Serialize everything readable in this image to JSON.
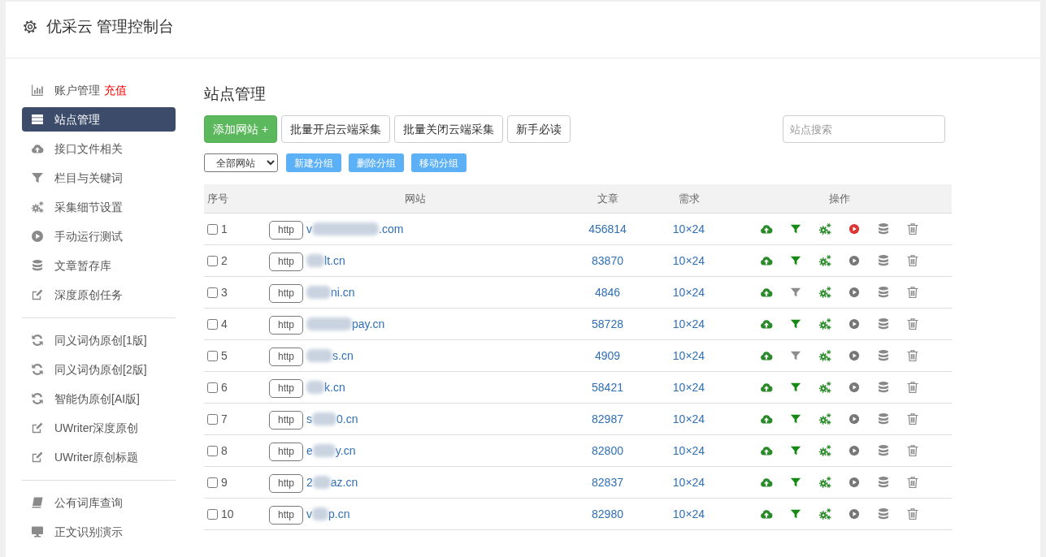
{
  "header": {
    "title": "优采云 管理控制台"
  },
  "sidebar": {
    "groups": [
      {
        "items": [
          {
            "label": "账户管理",
            "badge": "充值",
            "selected": false
          },
          {
            "label": "站点管理",
            "selected": true
          },
          {
            "label": "接口文件相关",
            "selected": false
          },
          {
            "label": "栏目与关键词",
            "selected": false
          },
          {
            "label": "采集细节设置",
            "selected": false
          },
          {
            "label": "手动运行测试",
            "selected": false
          },
          {
            "label": "文章暂存库",
            "selected": false
          },
          {
            "label": "深度原创任务",
            "selected": false
          }
        ]
      },
      {
        "items": [
          {
            "label": "同义词伪原创[1版]",
            "selected": false
          },
          {
            "label": "同义词伪原创[2版]",
            "selected": false
          },
          {
            "label": "智能伪原创[AI版]",
            "selected": false
          },
          {
            "label": "UWriter深度原创",
            "selected": false
          },
          {
            "label": "UWriter原创标题",
            "selected": false
          }
        ]
      },
      {
        "items": [
          {
            "label": "公有词库查询",
            "selected": false
          },
          {
            "label": "正文识别演示",
            "selected": false
          }
        ]
      }
    ]
  },
  "page": {
    "title": "站点管理"
  },
  "toolbar": {
    "buttons": [
      {
        "label": "添加网站 +",
        "kind": "primary"
      },
      {
        "label": "批量开启云端采集",
        "kind": "default"
      },
      {
        "label": "批量关闭云端采集",
        "kind": "default"
      },
      {
        "label": "新手必读",
        "kind": "default"
      }
    ],
    "search": {
      "placeholder": "站点搜索"
    }
  },
  "group_bar": {
    "select": {
      "value": "全部网站"
    },
    "buttons": [
      "新建分组",
      "删除分组",
      "移动分组"
    ]
  },
  "table": {
    "columns": [
      "序号",
      "网站",
      "文章",
      "需求",
      "操作"
    ],
    "rows": [
      {
        "checked": false,
        "number": "1",
        "protocol": "http",
        "site_start": "v",
        "site_end": ".com",
        "articles": "456814",
        "demand": "10×24",
        "filter_on": true,
        "running": true
      },
      {
        "checked": false,
        "number": "2",
        "protocol": "http",
        "site_end": "lt.cn",
        "articles": "83870",
        "demand": "10×24",
        "filter_on": true,
        "running": false
      },
      {
        "checked": false,
        "number": "3",
        "protocol": "http",
        "site_end": "ni.cn",
        "articles": "4846",
        "demand": "10×24",
        "filter_on": false,
        "running": false
      },
      {
        "checked": false,
        "number": "4",
        "protocol": "http",
        "site_end": "pay.cn",
        "articles": "58728",
        "demand": "10×24",
        "filter_on": true,
        "running": false
      },
      {
        "checked": false,
        "number": "5",
        "protocol": "http",
        "site_end": "s.cn",
        "articles": "4909",
        "demand": "10×24",
        "filter_on": false,
        "running": false
      },
      {
        "checked": false,
        "number": "6",
        "protocol": "http",
        "site_end": "k.cn",
        "articles": "58421",
        "demand": "10×24",
        "filter_on": true,
        "running": false
      },
      {
        "checked": false,
        "number": "7",
        "protocol": "http",
        "site_start": "s",
        "site_end": "0.cn",
        "articles": "82987",
        "demand": "10×24",
        "filter_on": true,
        "running": false
      },
      {
        "checked": false,
        "number": "8",
        "protocol": "http",
        "site_start": "e",
        "site_end": "y.cn",
        "articles": "82800",
        "demand": "10×24",
        "filter_on": true,
        "running": false
      },
      {
        "checked": false,
        "number": "9",
        "protocol": "http",
        "site_start": "2",
        "site_end": "az.cn",
        "articles": "82837",
        "demand": "10×24",
        "filter_on": true,
        "running": false
      },
      {
        "checked": false,
        "number": "10",
        "protocol": "http",
        "site_start": "v",
        "site_end": "p.cn",
        "articles": "82980",
        "demand": "10×24",
        "filter_on": true,
        "running": false
      }
    ]
  }
}
